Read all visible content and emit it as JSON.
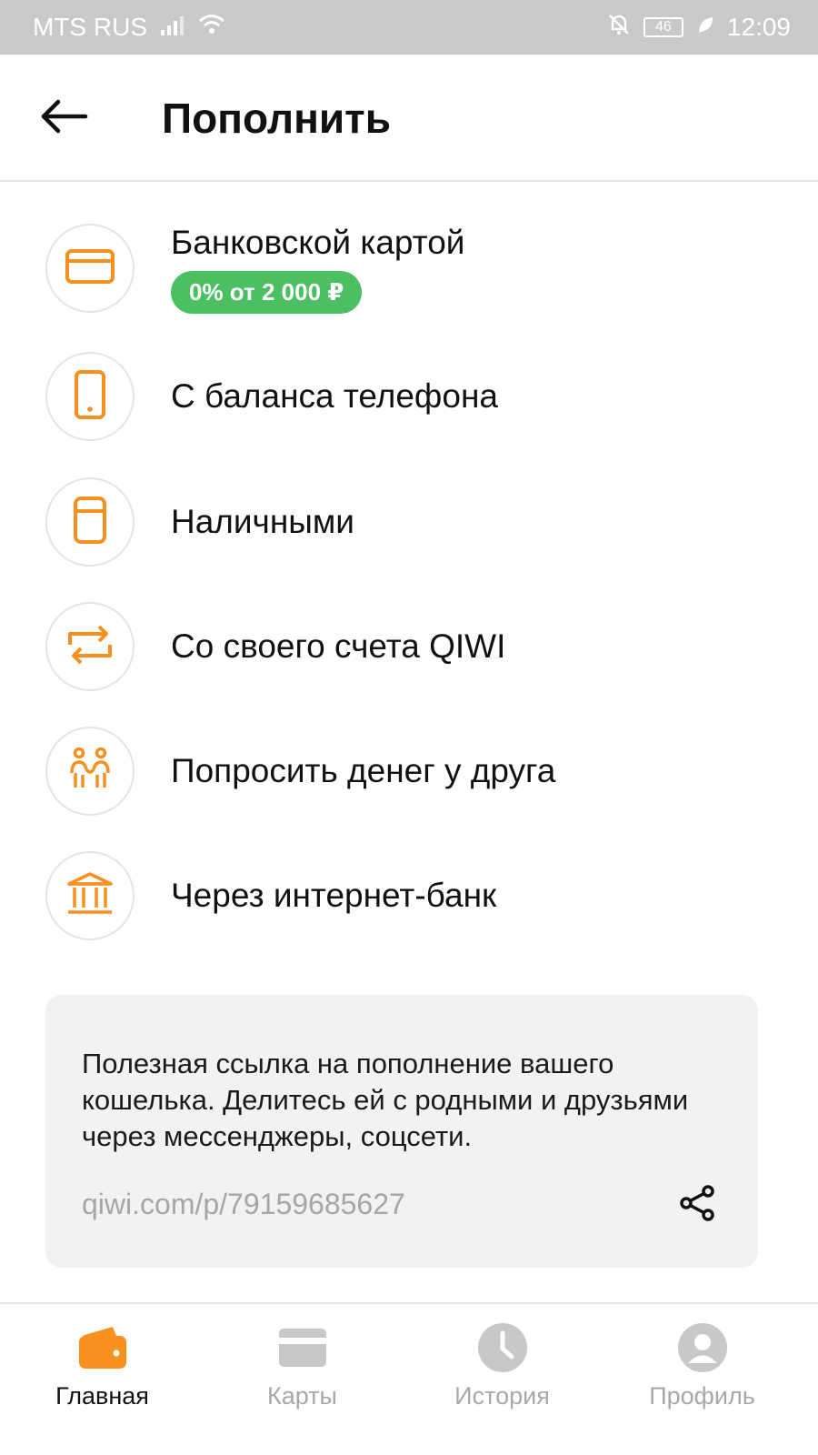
{
  "status_bar": {
    "carrier": "MTS RUS",
    "battery": "46",
    "time": "12:09",
    "icons": [
      "signal-icon",
      "wifi-icon",
      "mute-bell-icon",
      "battery-icon",
      "leaf-icon"
    ]
  },
  "header": {
    "title": "Пополнить",
    "back_icon": "arrow-left-icon"
  },
  "methods": [
    {
      "label": "Банковской картой",
      "badge": "0% от 2 000 ₽",
      "icon": "bank-card-icon"
    },
    {
      "label": "С баланса телефона",
      "icon": "phone-icon"
    },
    {
      "label": "Наличными",
      "icon": "cash-icon"
    },
    {
      "label": "Со своего счета QIWI",
      "icon": "transfer-arrows-icon"
    },
    {
      "label": "Попросить денег у друга",
      "icon": "friends-icon"
    },
    {
      "label": "Через интернет-банк",
      "icon": "bank-building-icon"
    }
  ],
  "share_card": {
    "description": "Полезная ссылка на пополнение вашего кошелька. Делитесь ей с родными и друзьями через мессенджеры, соцсети.",
    "link": "qiwi.com/p/79159685627",
    "share_icon": "share-icon"
  },
  "bottom_nav": {
    "active": "Главная",
    "items": [
      {
        "label": "Главная",
        "icon": "wallet-icon"
      },
      {
        "label": "Карты",
        "icon": "cards-icon"
      },
      {
        "label": "История",
        "icon": "clock-icon"
      },
      {
        "label": "Профиль",
        "icon": "profile-icon"
      }
    ]
  },
  "colors": {
    "accent": "#f7901e",
    "badge": "#4cbf63",
    "statusbar": "#c9c9c9",
    "inactive": "#a8a8a8"
  }
}
